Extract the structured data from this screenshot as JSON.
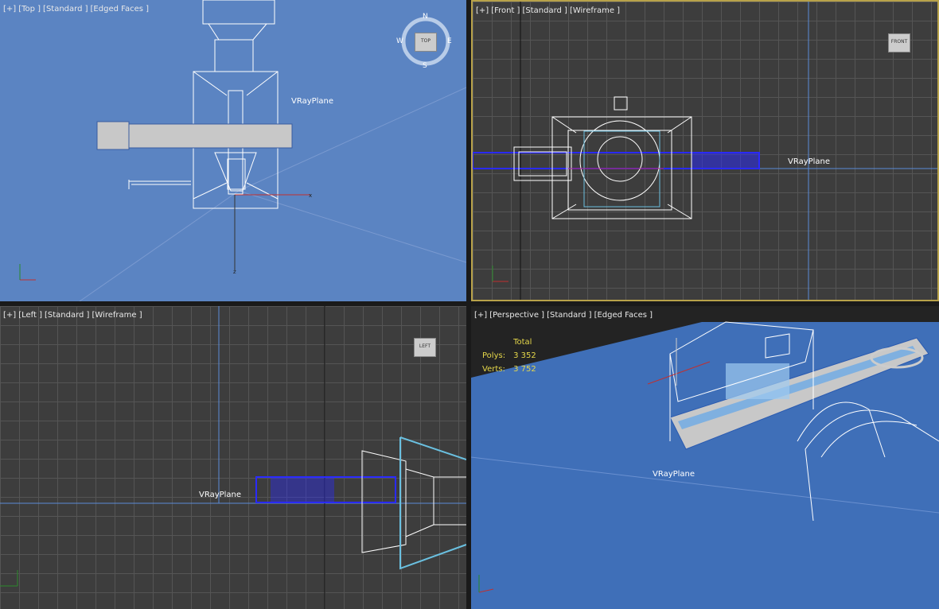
{
  "viewports": {
    "top": {
      "labels": [
        "[+]",
        "[Top ]",
        "[Standard ]",
        "[Edged Faces ]"
      ],
      "object": "VRayPlane",
      "cube": "TOP",
      "compass": [
        "N",
        "E",
        "S",
        "W"
      ]
    },
    "front": {
      "labels": [
        "[+]",
        "[Front ]",
        "[Standard ]",
        "[Wireframe ]"
      ],
      "object": "VRayPlane",
      "cube": "FRONT",
      "active": true
    },
    "left": {
      "labels": [
        "[+]",
        "[Left ]",
        "[Standard ]",
        "[Wireframe ]"
      ],
      "object": "VRayPlane",
      "cube": "LEFT"
    },
    "perspective": {
      "labels": [
        "[+]",
        "[Perspective ]",
        "[Standard ]",
        "[Edged Faces ]"
      ],
      "object": "VRayPlane",
      "stats": {
        "header": "Total",
        "polys_label": "Polys:",
        "polys": "3 352",
        "verts_label": "Verts:",
        "verts": "3 752"
      }
    }
  },
  "colors": {
    "top_bg": "#5b84c2",
    "grid_bg": "#3d3d3d",
    "active_border": "#b8a24a",
    "stats_text": "#e6d84a",
    "selection": "#2a2aff"
  }
}
